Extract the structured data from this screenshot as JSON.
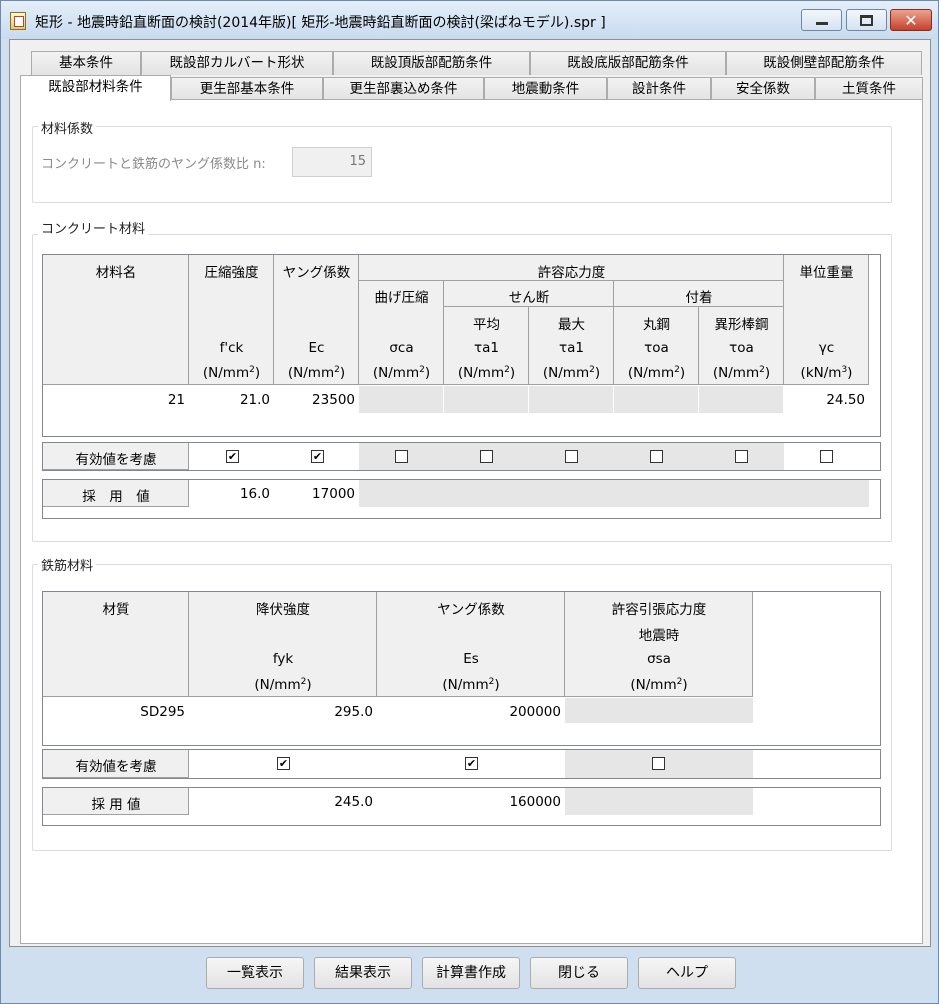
{
  "window": {
    "title": "矩形 - 地震時鉛直断面の検討(2014年版)[ 矩形-地震時鉛直断面の検討(梁ばねモデル).spr ]"
  },
  "tabs_row1": [
    "基本条件",
    "既設部カルバート形状",
    "既設頂版部配筋条件",
    "既設底版部配筋条件",
    "既設側壁部配筋条件"
  ],
  "tabs_row2": [
    "既設部材料条件",
    "更生部基本条件",
    "更生部裏込め条件",
    "地震動条件",
    "設計条件",
    "安全係数",
    "土質条件"
  ],
  "material_coef": {
    "group_label": "材料係数",
    "label": "コンクリートと鉄筋のヤング係数比 n:",
    "value": "15"
  },
  "concrete": {
    "group_label": "コンクリート材料",
    "headers": {
      "name": "材料名",
      "fck_title": "圧縮強度",
      "fck_sym": "f'ck",
      "fck_unit": "(N/mm",
      "ec_title": "ヤング係数",
      "ec_sym": "Ec",
      "ec_unit": "(N/mm",
      "allow": "許容応力度",
      "bend": "曲げ圧縮",
      "sca": "σca",
      "shear": "せん断",
      "avg": "平均",
      "max": "最大",
      "ta1a": "τa1",
      "ta1b": "τa1",
      "bond": "付着",
      "round": "丸鋼",
      "deform": "異形棒鋼",
      "toa1": "τoa",
      "toa2": "τoa",
      "unitwt": "単位重量",
      "gamma": "γc",
      "unit_mpa": "(N/mm",
      "unit_kn": "(kN/m"
    },
    "row": {
      "name": "21",
      "fck": "21.0",
      "ec": "23500",
      "gamma": "24.50"
    },
    "consider_label": "有効値を考慮",
    "adopt_label": "採　用　値",
    "adopt": {
      "fck": "16.0",
      "ec": "17000"
    }
  },
  "rebar": {
    "group_label": "鉄筋材料",
    "headers": {
      "grade": "材質",
      "fyk_title": "降伏強度",
      "fyk_sym": "fyk",
      "es_title": "ヤング係数",
      "es_sym": "Es",
      "allow_title": "許容引張応力度",
      "allow_sub": "地震時",
      "sa_sym": "σsa",
      "unit": "(N/mm"
    },
    "row": {
      "grade": "SD295",
      "fyk": "295.0",
      "es": "200000"
    },
    "consider_label": "有効値を考慮",
    "adopt_label": "採 用 値",
    "adopt": {
      "fyk": "245.0",
      "es": "160000"
    }
  },
  "buttons": [
    "一覧表示",
    "結果表示",
    "計算書作成",
    "閉じる",
    "ヘルプ"
  ],
  "icons": {
    "minimize": "minimize-icon",
    "maximize": "maximize-icon",
    "close": "close-icon",
    "check": "✔"
  }
}
